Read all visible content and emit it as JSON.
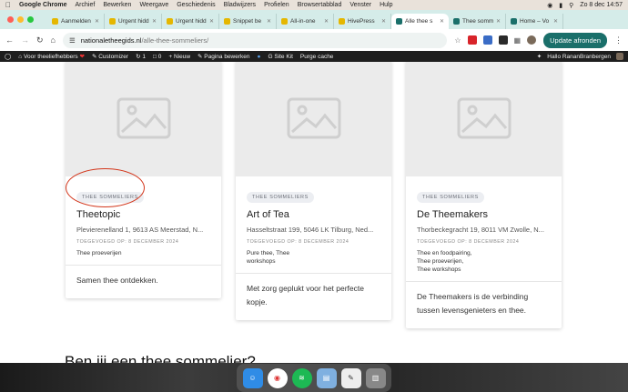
{
  "menubar": {
    "app": "Google Chrome",
    "items": [
      "Archief",
      "Bewerken",
      "Weergave",
      "Geschiedenis",
      "Bladwijzers",
      "Profielen",
      "Browsertabblad",
      "Venster",
      "Hulp"
    ],
    "datetime": "Zo 8 dec  14:57"
  },
  "tabs": [
    {
      "label": "Aanmelden",
      "color": "#e5b700"
    },
    {
      "label": "Urgent hidd",
      "color": "#e5b700"
    },
    {
      "label": "Urgent hidd",
      "color": "#e5b700"
    },
    {
      "label": "Snippet be",
      "color": "#e5b700"
    },
    {
      "label": "All-in-one",
      "color": "#e5b700"
    },
    {
      "label": "HivePress",
      "color": "#e5b700"
    },
    {
      "label": "Alle thee s",
      "color": "#1a6f6a",
      "active": true
    },
    {
      "label": "Thee somm",
      "color": "#1a6f6a"
    },
    {
      "label": "Home – Vo",
      "color": "#1a6f6a"
    }
  ],
  "address": {
    "domain": "nationaletheegids.nl",
    "path": "/alle-thee-sommeliers/"
  },
  "update_button": "Update afronden",
  "wpbar": {
    "site": "Voor theeliefhebbers",
    "customize": "Customizer",
    "updates": "1",
    "comments": "0",
    "new": "Nieuw",
    "edit": "Pagina bewerken",
    "sitekit": "Site Kit",
    "purge": "Purge cache",
    "greeting": "Hallo RananBranbergen"
  },
  "cards": [
    {
      "chip": "THEE SOMMELIERS",
      "title": "Theetopic",
      "address": "Plevierenelland 1, 9613 AS Meerstad, N...",
      "date": "TOEGEVOEGD OP: 8 DECEMBER 2024",
      "tags": [
        "Thee proeverijen"
      ],
      "description": "Samen thee ontdekken."
    },
    {
      "chip": "THEE SOMMELIERS",
      "title": "Art of Tea",
      "address": "Hasseltstraat 199, 5046 LK Tilburg, Ned...",
      "date": "TOEGEVOEGD OP: 8 DECEMBER 2024",
      "tags": [
        "Pure thee, Thee",
        "workshops"
      ],
      "description": "Met zorg geplukt voor het perfecte kopje."
    },
    {
      "chip": "THEE SOMMELIERS",
      "title": "De Theemakers",
      "address": "Thorbeckegracht 19, 8011 VM Zwolle, N...",
      "date": "TOEGEVOEGD OP: 8 DECEMBER 2024",
      "tags": [
        "Thee en foodpairing,",
        "Thee proeverijen,",
        "Thee workshops"
      ],
      "description": "De Theemakers is de verbinding tussen levensgenieters en thee."
    }
  ],
  "heading": "Ben jij een thee sommelier?"
}
